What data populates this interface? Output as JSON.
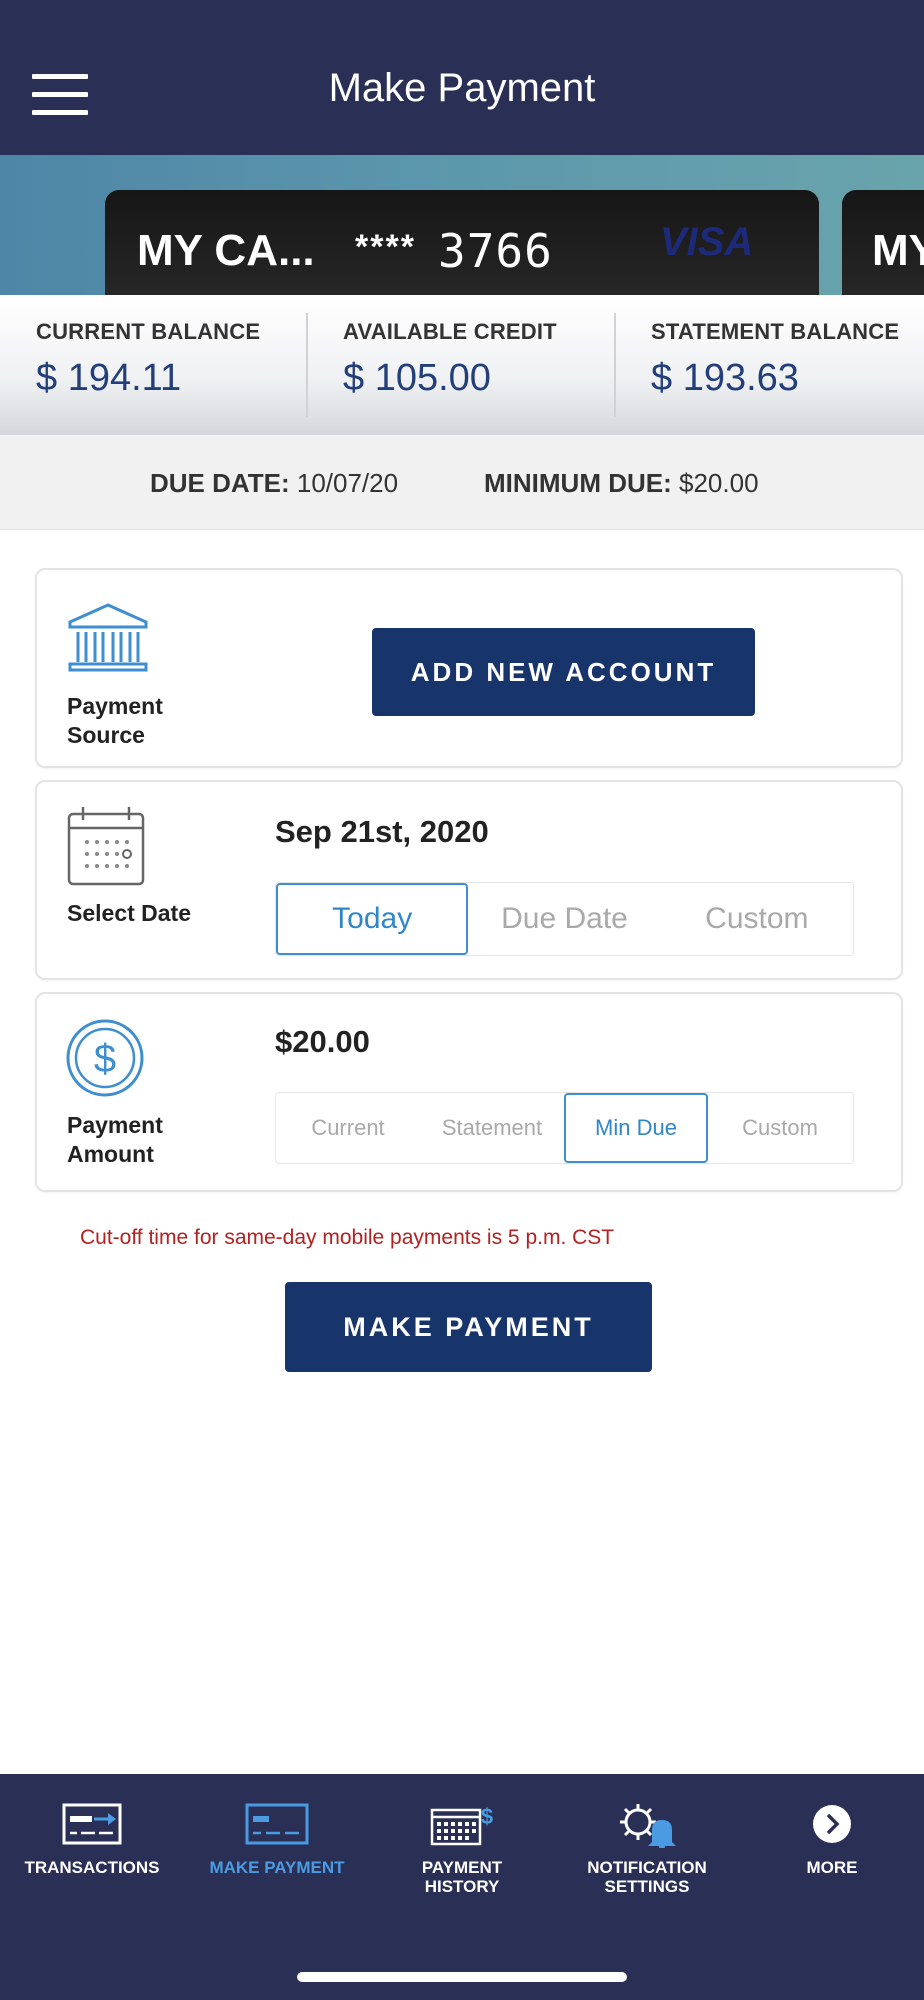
{
  "header": {
    "title": "Make Payment"
  },
  "card": {
    "name": "MY CA...",
    "mask": "****",
    "last4": "3766",
    "brand": "VISA",
    "next_name": "MY"
  },
  "balances": [
    {
      "label": "CURRENT BALANCE",
      "value": "$ 194.11"
    },
    {
      "label": "AVAILABLE CREDIT",
      "value": "$ 105.00"
    },
    {
      "label": "STATEMENT BALANCE",
      "value": "$ 193.63"
    }
  ],
  "due": {
    "date_label": "DUE DATE:",
    "date_value": "10/07/20",
    "min_label": "MINIMUM DUE:",
    "min_value": "$20.00"
  },
  "payment_source": {
    "label_line1": "Payment",
    "label_line2": "Source",
    "button": "ADD NEW ACCOUNT"
  },
  "select_date": {
    "label": "Select Date",
    "value": "Sep 21st, 2020",
    "options": [
      "Today",
      "Due Date",
      "Custom"
    ],
    "selected": "Today"
  },
  "payment_amount": {
    "label_line1": "Payment",
    "label_line2": "Amount",
    "value": "$20.00",
    "options": [
      "Current",
      "Statement",
      "Min Due",
      "Custom"
    ],
    "selected": "Min Due"
  },
  "cutoff_note": "Cut-off time for same-day mobile payments is 5 p.m. CST",
  "make_payment_button": "MAKE PAYMENT",
  "bottom_nav": [
    {
      "line1": "TRANSACTIONS",
      "line2": "",
      "icon": "transactions-icon"
    },
    {
      "line1": "MAKE PAYMENT",
      "line2": "",
      "icon": "make-payment-icon"
    },
    {
      "line1": "PAYMENT",
      "line2": "HISTORY",
      "icon": "payment-history-icon"
    },
    {
      "line1": "NOTIFICATION",
      "line2": "SETTINGS",
      "icon": "notification-settings-icon"
    },
    {
      "line1": "MORE",
      "line2": "",
      "icon": "more-icon"
    }
  ],
  "colors": {
    "header": "#2a2f55",
    "button": "#17356b",
    "accent": "#3e8ed0",
    "value": "#233f79",
    "warning": "#b32121"
  }
}
